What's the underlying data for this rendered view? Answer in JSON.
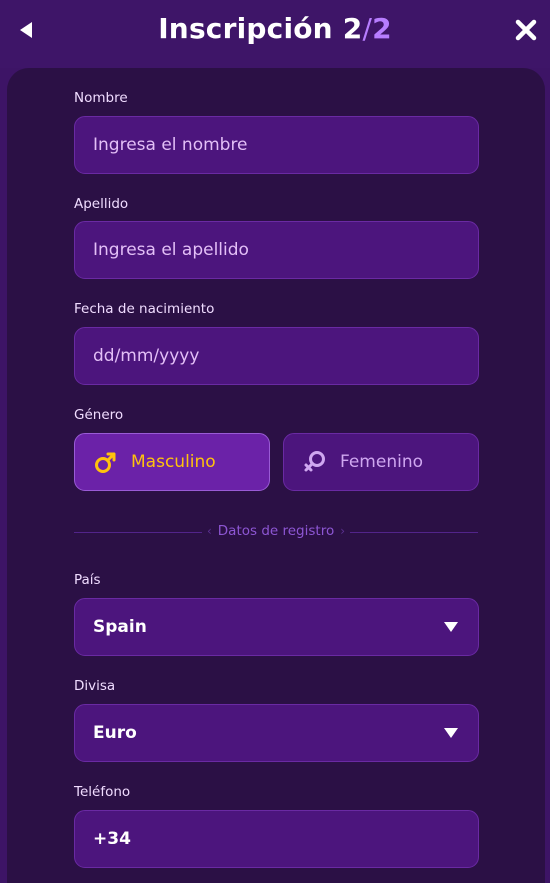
{
  "header": {
    "title": "Inscripción",
    "step_current": "2",
    "step_separator": "/",
    "step_total": "2",
    "back_icon": "chevron-left-icon",
    "close_icon": "close-icon"
  },
  "form": {
    "nombre": {
      "label": "Nombre",
      "placeholder": "Ingresa el nombre"
    },
    "apellido": {
      "label": "Apellido",
      "placeholder": "Ingresa el apellido"
    },
    "fecha": {
      "label": "Fecha de nacimiento",
      "placeholder": "dd/mm/yyyy"
    },
    "genero": {
      "label": "Género",
      "options": [
        {
          "label": "Masculino",
          "icon": "male-icon",
          "selected": true
        },
        {
          "label": "Femenino",
          "icon": "female-icon",
          "selected": false
        }
      ]
    },
    "divider_text": "Datos de registro",
    "pais": {
      "label": "País",
      "value": "Spain"
    },
    "divisa": {
      "label": "Divisa",
      "value": "Euro"
    },
    "telefono": {
      "label": "Teléfono",
      "value": "+34"
    }
  },
  "colors": {
    "background": "#3d1466",
    "panel": "#2b1045",
    "field": "#4c157d",
    "accent": "#b77dff",
    "selected_text": "#ffc20d"
  }
}
